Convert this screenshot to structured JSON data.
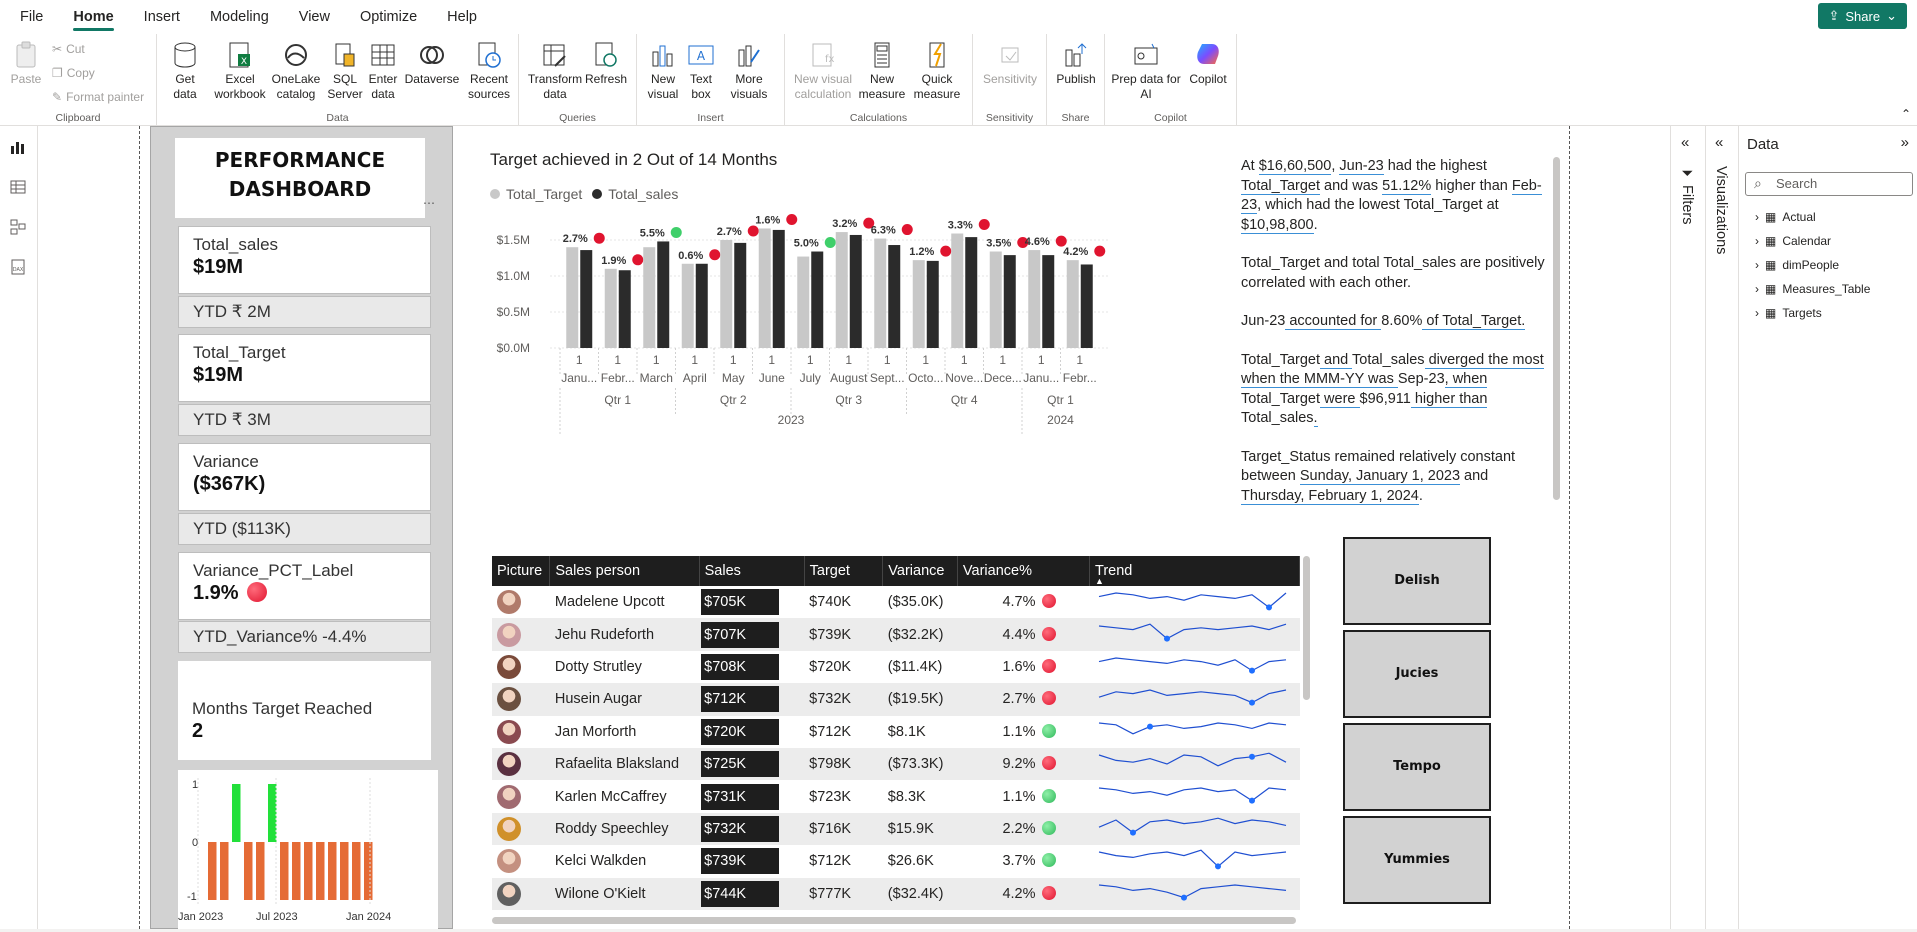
{
  "menu": {
    "items": [
      "File",
      "Home",
      "Insert",
      "Modeling",
      "View",
      "Optimize",
      "Help"
    ],
    "share": "Share"
  },
  "ribbon": {
    "clipboard": {
      "label": "Clipboard",
      "paste": "Paste",
      "cut": "Cut",
      "copy": "Copy",
      "format_painter": "Format painter"
    },
    "data": {
      "label": "Data",
      "get_data": "Get data",
      "excel": "Excel workbook",
      "onelake": "OneLake catalog",
      "sql": "SQL Server",
      "enter": "Enter data",
      "dataverse": "Dataverse",
      "recent": "Recent sources"
    },
    "queries": {
      "label": "Queries",
      "transform": "Transform data",
      "refresh": "Refresh"
    },
    "insert": {
      "label": "Insert",
      "new_visual": "New visual",
      "text_box": "Text box",
      "more_visuals": "More visuals"
    },
    "calculations": {
      "label": "Calculations",
      "new_visual_calc": "New visual calculation",
      "new_measure": "New measure",
      "quick_measure": "Quick measure"
    },
    "sensitivity": {
      "label": "Sensitivity",
      "btn": "Sensitivity"
    },
    "share": {
      "label": "Share",
      "publish": "Publish"
    },
    "copilot": {
      "label": "Copilot",
      "prep": "Prep data for AI",
      "copilot": "Copilot"
    }
  },
  "dashboard": {
    "title_line1": "PERFORMANCE",
    "title_line2": "DASHBOARD",
    "cards": [
      {
        "label": "Total_sales",
        "value": "$19M",
        "ytd": "YTD ₹ 2M"
      },
      {
        "label": "Total_Target",
        "value": "$19M",
        "ytd": "YTD ₹ 3M"
      },
      {
        "label": "Variance",
        "value": "($367K)",
        "ytd": "YTD ($113K)"
      },
      {
        "label": "Variance_PCT_Label",
        "value": "1.9%",
        "ytd": "YTD_Variance% -4.4%"
      }
    ],
    "months_reached": {
      "label": "Months Target Reached",
      "value": "2"
    }
  },
  "mini_chart": {
    "y_ticks": [
      "1",
      "0",
      "-1"
    ],
    "x_labels": [
      "Jan 2023",
      "Jul 2023",
      "Jan 2024"
    ],
    "values": [
      -1,
      -1,
      1,
      -1,
      -1,
      1,
      -1,
      -1,
      -1,
      -1,
      -1,
      -1,
      -1,
      -1
    ],
    "colors": {
      "pos": "#22e03a",
      "neg": "#e56b35"
    }
  },
  "chart_data": {
    "type": "bar",
    "title": "Target achieved in 2 Out of 14 Months",
    "legend": [
      "Total_Target",
      "Total_sales"
    ],
    "legend_colors": [
      "#c8c8c8",
      "#2b2b2b"
    ],
    "y_ticks": [
      "$1.5M",
      "$1.0M",
      "$0.5M",
      "$0.0M"
    ],
    "ylim": [
      0,
      1.8
    ],
    "categories": [
      "Janu...",
      "Febr...",
      "March",
      "April",
      "May",
      "June",
      "July",
      "August",
      "Sept...",
      "Octo...",
      "Nove...",
      "Dece...",
      "Janu...",
      "Febr..."
    ],
    "day_labels": [
      "1",
      "1",
      "1",
      "1",
      "1",
      "1",
      "1",
      "1",
      "1",
      "1",
      "1",
      "1",
      "1",
      "1"
    ],
    "quarters": [
      {
        "label": "Qtr 1",
        "span": 3
      },
      {
        "label": "Qtr 2",
        "span": 3
      },
      {
        "label": "Qtr 3",
        "span": 3
      },
      {
        "label": "Qtr 4",
        "span": 3
      },
      {
        "label": "Qtr 1",
        "span": 2
      }
    ],
    "years": [
      {
        "label": "2023",
        "span": 12
      },
      {
        "label": "2024",
        "span": 2
      }
    ],
    "series": [
      {
        "name": "Total_Target",
        "values": [
          1.4,
          1.1,
          1.4,
          1.17,
          1.5,
          1.66,
          1.27,
          1.61,
          1.52,
          1.22,
          1.59,
          1.34,
          1.36,
          1.22
        ]
      },
      {
        "name": "Total_sales",
        "values": [
          1.36,
          1.08,
          1.48,
          1.17,
          1.46,
          1.64,
          1.34,
          1.57,
          1.43,
          1.21,
          1.54,
          1.29,
          1.29,
          1.16
        ]
      }
    ],
    "labels": [
      "2.7%",
      "1.9%",
      "5.5%",
      "0.6%",
      "2.7%",
      "1.6%",
      "5.0%",
      "3.2%",
      "6.3%",
      "1.2%",
      "3.3%",
      "3.5%",
      "4.6%",
      "4.2%"
    ],
    "status": [
      "red",
      "red",
      "green",
      "red",
      "red",
      "red",
      "green",
      "red",
      "red",
      "red",
      "red",
      "red",
      "red",
      "red"
    ]
  },
  "insights": {
    "p1": [
      "At ",
      "$16,60,500",
      ", ",
      "Jun-23",
      " had the highest ",
      "Total_Target",
      " and was ",
      "51.12%",
      " higher than ",
      "Feb-23",
      ", which had the lowest Total_Target at ",
      "$10,98,800",
      "."
    ],
    "p2": "Total_Target and total Total_sales are positively correlated with each other.",
    "p3": [
      "Jun-23",
      " accounted for ",
      "8.60%",
      " of Total_Target."
    ],
    "p4": [
      "Total_Target",
      " and ",
      "Total_sales",
      " diverged the most when the MMM-YY was ",
      "Sep-23",
      ", when ",
      "Total_Target",
      " were ",
      "$96,911",
      " higher than ",
      "Total_sales",
      "."
    ],
    "p5": [
      "Target_Status remained relatively constant between ",
      "Sunday, January 1, 2023",
      " and ",
      "Thursday, February 1, 2024",
      "."
    ]
  },
  "table": {
    "headers": [
      "Picture",
      "Sales person",
      "Sales",
      "Target",
      "Variance",
      "Variance%",
      "Trend"
    ],
    "rows": [
      {
        "name": "Madelene Upcott",
        "sales": "$705K",
        "target": "$740K",
        "variance": "($35.0K)",
        "pct": "4.7%",
        "status": "red",
        "color": "#b07a6a"
      },
      {
        "name": "Jehu Rudeforth",
        "sales": "$707K",
        "target": "$739K",
        "variance": "($32.2K)",
        "pct": "4.4%",
        "status": "red",
        "color": "#c99aa0"
      },
      {
        "name": "Dotty Strutley",
        "sales": "$708K",
        "target": "$720K",
        "variance": "($11.4K)",
        "pct": "1.6%",
        "status": "red",
        "color": "#7a4a3a"
      },
      {
        "name": "Husein Augar",
        "sales": "$712K",
        "target": "$732K",
        "variance": "($19.5K)",
        "pct": "2.7%",
        "status": "red",
        "color": "#6b5040"
      },
      {
        "name": "Jan Morforth",
        "sales": "$720K",
        "target": "$712K",
        "variance": "$8.1K",
        "pct": "1.1%",
        "status": "green",
        "color": "#8a4a50"
      },
      {
        "name": "Rafaelita Blaksland",
        "sales": "$725K",
        "target": "$798K",
        "variance": "($73.3K)",
        "pct": "9.2%",
        "status": "red",
        "color": "#5a3040"
      },
      {
        "name": "Karlen McCaffrey",
        "sales": "$731K",
        "target": "$723K",
        "variance": "$8.3K",
        "pct": "1.1%",
        "status": "green",
        "color": "#a06a70"
      },
      {
        "name": "Roddy Speechley",
        "sales": "$732K",
        "target": "$716K",
        "variance": "$15.9K",
        "pct": "2.2%",
        "status": "green",
        "color": "#d0902a"
      },
      {
        "name": "Kelci Walkden",
        "sales": "$739K",
        "target": "$712K",
        "variance": "$26.6K",
        "pct": "3.7%",
        "status": "green",
        "color": "#c49080"
      },
      {
        "name": "Wilone O'Kielt",
        "sales": "$744K",
        "target": "$777K",
        "variance": "($32.4K)",
        "pct": "4.2%",
        "status": "red",
        "color": "#606060"
      }
    ]
  },
  "slicers": [
    "Delish",
    "Jucies",
    "Tempo",
    "Yummies"
  ],
  "panes": {
    "filters": "Filters",
    "visualizations": "Visualizations",
    "data": "Data",
    "search_placeholder": "Search",
    "tables": [
      "Actual",
      "Calendar",
      "dimPeople",
      "Measures_Table",
      "Targets"
    ]
  },
  "colors": {
    "accent": "#117865",
    "red": "#e0142f",
    "green": "#3fcf6a",
    "bar_dark": "#2b2b2b",
    "bar_light": "#c8c8c8",
    "trend": "#1f4fd1"
  }
}
